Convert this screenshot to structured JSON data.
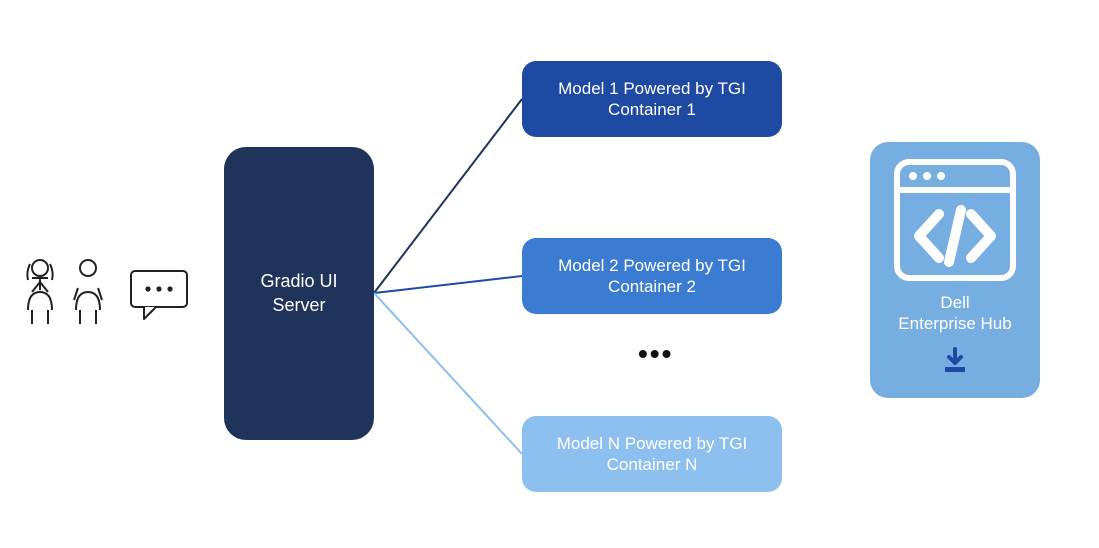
{
  "icons": {
    "woman": "woman-icon",
    "man": "man-icon",
    "chat": "chat-icon",
    "code_window": "code-window-icon",
    "download": "download-icon"
  },
  "server": {
    "label": "Gradio UI Server"
  },
  "containers": [
    {
      "label": "Model 1 Powered by TGI Container 1",
      "color": "#1f4aa3"
    },
    {
      "label": "Model 2 Powered by TGI Container 2",
      "color": "#3b7bd1"
    },
    {
      "label": "Model N Powered by TGI Container N",
      "color": "#8dc0ef"
    }
  ],
  "ellipsis": "•••",
  "hub": {
    "title_line1": "Dell",
    "title_line2": "Enterprise Hub"
  },
  "line_colors": {
    "c1": "#20335a",
    "c2": "#1f4aa3",
    "c3": "#8dc0ef"
  }
}
